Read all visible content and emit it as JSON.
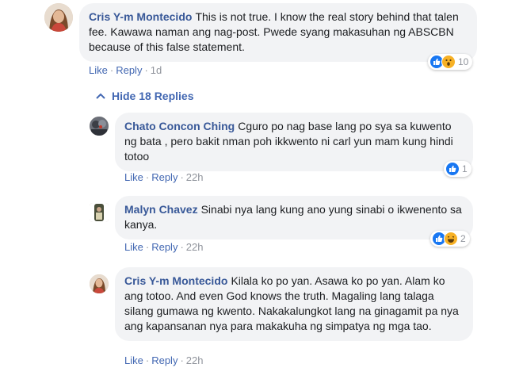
{
  "comments": [
    {
      "author": "Cris Y-m Montecido",
      "text": "This is not true. I know the real story behind that talen fee. Kawawa naman ang nag-post. Pwede syang makasuhan ng ABSCBN because of this false statement.",
      "like_label": "Like",
      "reply_label": "Reply",
      "time": "1d",
      "reaction_icons": [
        "like-icon",
        "wow-icon"
      ],
      "reaction_count": "10"
    }
  ],
  "hide_replies_label": "Hide 18 Replies",
  "replies": [
    {
      "author": "Chato Concon Ching",
      "text": "Cguro po nag base lang po sya sa kuwento ng bata , pero bakit nman poh ikkwento ni carl yun mam kung hindi totoo",
      "like_label": "Like",
      "reply_label": "Reply",
      "time": "22h",
      "reaction_icons": [
        "like-icon"
      ],
      "reaction_count": "1"
    },
    {
      "author": "Malyn Chavez",
      "text": "Sinabi nya lang kung ano yung sinabi o ikwenento sa kanya.",
      "like_label": "Like",
      "reply_label": "Reply",
      "time": "22h",
      "reaction_icons": [
        "like-icon",
        "haha-icon"
      ],
      "reaction_count": "2"
    },
    {
      "author": "Cris Y-m Montecido",
      "text": "Kilala ko po yan. Asawa ko po yan. Alam ko ang totoo. And even God knows the truth. Magaling lang talaga silang gumawa ng kwento. Nakakalungkot lang na ginagamit pa nya ang kapansanan nya para makakuha ng simpatya ng mga tao.",
      "like_label": "Like",
      "reply_label": "Reply",
      "time": "22h"
    }
  ],
  "colors": {
    "link": "#4267b2",
    "author": "#385898",
    "bubble": "#f2f3f5",
    "meta": "#90949c",
    "like": "#1877f2",
    "emoji": "#f7b125"
  }
}
